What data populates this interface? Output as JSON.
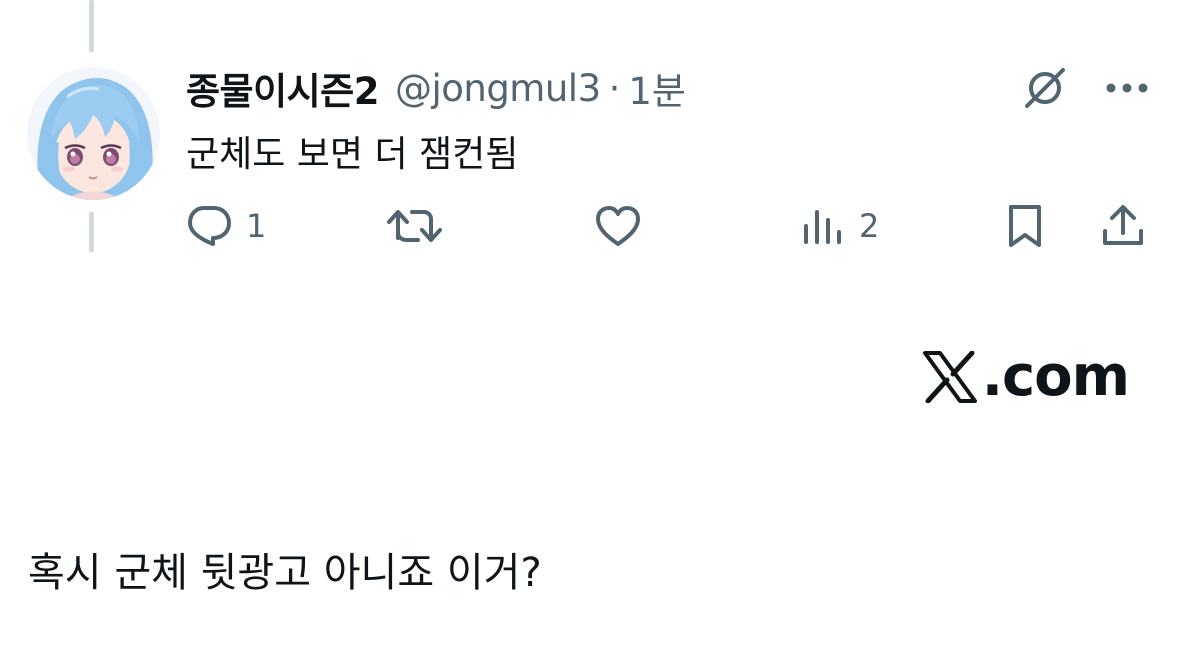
{
  "tweet": {
    "display_name": "종물이시즌2",
    "handle": "@jongmul3",
    "separator": "·",
    "time": "1분",
    "text": "군체도 보면 더 잼컨됨",
    "avatar_icon": "anime-girl-avatar"
  },
  "actions": {
    "reply_count": "1",
    "views_count": "2"
  },
  "icons": {
    "grok": "grok-icon",
    "more": "more-dots-icon",
    "reply": "reply-icon",
    "retweet": "retweet-icon",
    "like": "heart-icon",
    "views": "views-icon",
    "bookmark": "bookmark-icon",
    "share": "share-icon"
  },
  "brand": {
    "text": ".com"
  },
  "caption": "혹시 군체 뒷광고 아니죠 이거?",
  "colors": {
    "text_primary": "#0f1419",
    "text_secondary": "#536471",
    "thread_line": "#cfd9de",
    "background": "#ffffff"
  }
}
